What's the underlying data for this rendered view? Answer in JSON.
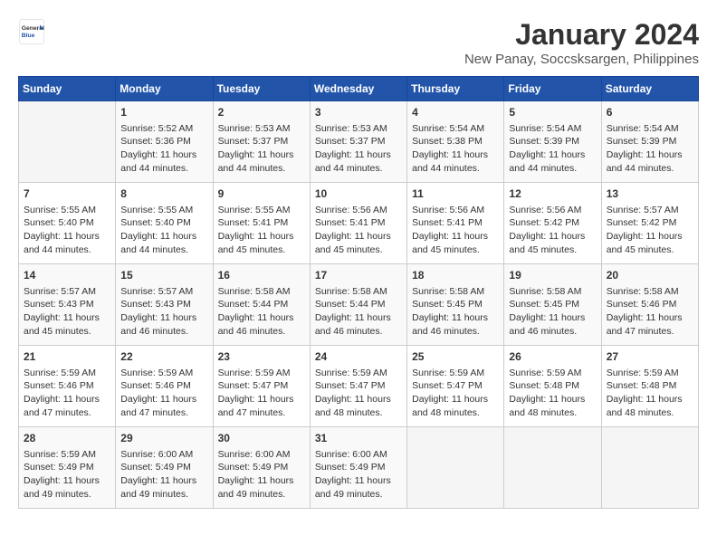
{
  "header": {
    "logo": {
      "general": "General",
      "blue": "Blue"
    },
    "title": "January 2024",
    "subtitle": "New Panay, Soccsksargen, Philippines"
  },
  "weekdays": [
    "Sunday",
    "Monday",
    "Tuesday",
    "Wednesday",
    "Thursday",
    "Friday",
    "Saturday"
  ],
  "weeks": [
    [
      {
        "day": "",
        "empty": true
      },
      {
        "day": "1",
        "sunrise": "5:52 AM",
        "sunset": "5:36 PM",
        "daylight": "11 hours and 44 minutes."
      },
      {
        "day": "2",
        "sunrise": "5:53 AM",
        "sunset": "5:37 PM",
        "daylight": "11 hours and 44 minutes."
      },
      {
        "day": "3",
        "sunrise": "5:53 AM",
        "sunset": "5:37 PM",
        "daylight": "11 hours and 44 minutes."
      },
      {
        "day": "4",
        "sunrise": "5:54 AM",
        "sunset": "5:38 PM",
        "daylight": "11 hours and 44 minutes."
      },
      {
        "day": "5",
        "sunrise": "5:54 AM",
        "sunset": "5:39 PM",
        "daylight": "11 hours and 44 minutes."
      },
      {
        "day": "6",
        "sunrise": "5:54 AM",
        "sunset": "5:39 PM",
        "daylight": "11 hours and 44 minutes."
      }
    ],
    [
      {
        "day": "7",
        "sunrise": "5:55 AM",
        "sunset": "5:40 PM",
        "daylight": "11 hours and 44 minutes."
      },
      {
        "day": "8",
        "sunrise": "5:55 AM",
        "sunset": "5:40 PM",
        "daylight": "11 hours and 44 minutes."
      },
      {
        "day": "9",
        "sunrise": "5:55 AM",
        "sunset": "5:41 PM",
        "daylight": "11 hours and 45 minutes."
      },
      {
        "day": "10",
        "sunrise": "5:56 AM",
        "sunset": "5:41 PM",
        "daylight": "11 hours and 45 minutes."
      },
      {
        "day": "11",
        "sunrise": "5:56 AM",
        "sunset": "5:41 PM",
        "daylight": "11 hours and 45 minutes."
      },
      {
        "day": "12",
        "sunrise": "5:56 AM",
        "sunset": "5:42 PM",
        "daylight": "11 hours and 45 minutes."
      },
      {
        "day": "13",
        "sunrise": "5:57 AM",
        "sunset": "5:42 PM",
        "daylight": "11 hours and 45 minutes."
      }
    ],
    [
      {
        "day": "14",
        "sunrise": "5:57 AM",
        "sunset": "5:43 PM",
        "daylight": "11 hours and 45 minutes."
      },
      {
        "day": "15",
        "sunrise": "5:57 AM",
        "sunset": "5:43 PM",
        "daylight": "11 hours and 46 minutes."
      },
      {
        "day": "16",
        "sunrise": "5:58 AM",
        "sunset": "5:44 PM",
        "daylight": "11 hours and 46 minutes."
      },
      {
        "day": "17",
        "sunrise": "5:58 AM",
        "sunset": "5:44 PM",
        "daylight": "11 hours and 46 minutes."
      },
      {
        "day": "18",
        "sunrise": "5:58 AM",
        "sunset": "5:45 PM",
        "daylight": "11 hours and 46 minutes."
      },
      {
        "day": "19",
        "sunrise": "5:58 AM",
        "sunset": "5:45 PM",
        "daylight": "11 hours and 46 minutes."
      },
      {
        "day": "20",
        "sunrise": "5:58 AM",
        "sunset": "5:46 PM",
        "daylight": "11 hours and 47 minutes."
      }
    ],
    [
      {
        "day": "21",
        "sunrise": "5:59 AM",
        "sunset": "5:46 PM",
        "daylight": "11 hours and 47 minutes."
      },
      {
        "day": "22",
        "sunrise": "5:59 AM",
        "sunset": "5:46 PM",
        "daylight": "11 hours and 47 minutes."
      },
      {
        "day": "23",
        "sunrise": "5:59 AM",
        "sunset": "5:47 PM",
        "daylight": "11 hours and 47 minutes."
      },
      {
        "day": "24",
        "sunrise": "5:59 AM",
        "sunset": "5:47 PM",
        "daylight": "11 hours and 48 minutes."
      },
      {
        "day": "25",
        "sunrise": "5:59 AM",
        "sunset": "5:47 PM",
        "daylight": "11 hours and 48 minutes."
      },
      {
        "day": "26",
        "sunrise": "5:59 AM",
        "sunset": "5:48 PM",
        "daylight": "11 hours and 48 minutes."
      },
      {
        "day": "27",
        "sunrise": "5:59 AM",
        "sunset": "5:48 PM",
        "daylight": "11 hours and 48 minutes."
      }
    ],
    [
      {
        "day": "28",
        "sunrise": "5:59 AM",
        "sunset": "5:49 PM",
        "daylight": "11 hours and 49 minutes."
      },
      {
        "day": "29",
        "sunrise": "6:00 AM",
        "sunset": "5:49 PM",
        "daylight": "11 hours and 49 minutes."
      },
      {
        "day": "30",
        "sunrise": "6:00 AM",
        "sunset": "5:49 PM",
        "daylight": "11 hours and 49 minutes."
      },
      {
        "day": "31",
        "sunrise": "6:00 AM",
        "sunset": "5:49 PM",
        "daylight": "11 hours and 49 minutes."
      },
      {
        "day": "",
        "empty": true
      },
      {
        "day": "",
        "empty": true
      },
      {
        "day": "",
        "empty": true
      }
    ]
  ]
}
